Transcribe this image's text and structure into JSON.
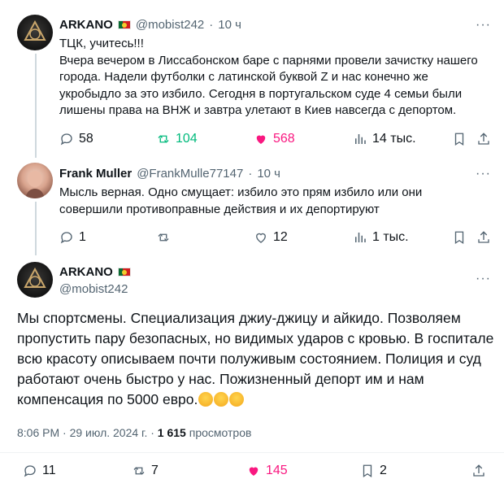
{
  "tweet1": {
    "name": "ARKANO",
    "handle": "@mobist242",
    "time": "10 ч",
    "lines": [
      "ТЦК, учитесь!!!",
      "Вчера вечером в Лиссабонском баре с парнями провели зачистку нашего",
      "города. Надели футболки с латинской буквой Z и нас конечно же",
      "укробыдло за это избило. Сегодня в португальском суде  4 семьи были",
      "лишены права на ВНЖ и завтра улетают в Киев навсегда с депортом."
    ],
    "replies": "58",
    "reposts": "104",
    "likes": "568",
    "views": "14 тыс."
  },
  "tweet2": {
    "name": "Frank Muller",
    "handle": "@FrankMulle77147",
    "time": "10 ч",
    "lines": [
      "Мысль верная. Одно смущает: избило это прям избило или они",
      "совершили противоправные действия и их депортируют"
    ],
    "replies": "1",
    "reposts": "",
    "likes": "12",
    "views": "1 тыс."
  },
  "tweet3": {
    "name": "ARKANO",
    "handle": "@mobist242",
    "lines": [
      "Мы спортсмены. Специализация джиу-джицу и айкидо. Позволяем",
      "пропустить пару безопасных, но видимых ударов с кровью. В госпитале",
      "всю красоту описываем почти полуживым состоянием. Полиция и суд",
      "работают очень быстро у нас. Пожизненный депорт им и нам",
      "компенсация по 5000 евро."
    ],
    "time": "8:06 PM",
    "date": "29 июл. 2024 г.",
    "views_count": "1 615",
    "views_label": "просмотров",
    "replies": "11",
    "reposts": "7",
    "likes": "145",
    "bookmarks": "2"
  },
  "separator_dot": "·",
  "more_label": "···",
  "colors": {
    "like": "#f91880",
    "repost": "#00ba7c",
    "muted": "#536471"
  },
  "icons": [
    "reply-icon",
    "repost-icon",
    "like-icon",
    "views-icon",
    "bookmark-icon",
    "share-icon",
    "more-icon",
    "portugal-flag-icon",
    "emoji-icon"
  ]
}
